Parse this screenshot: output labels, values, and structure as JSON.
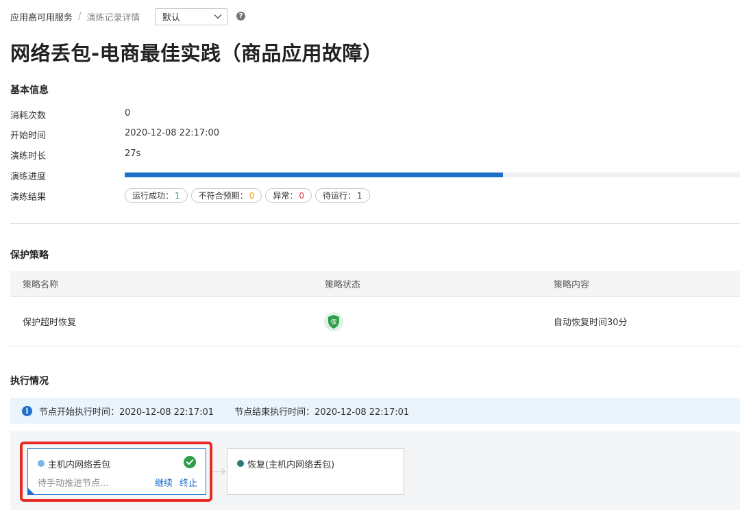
{
  "breadcrumb": {
    "root": "应用高可用服务",
    "separator": "/",
    "current": "演练记录详情"
  },
  "environment_select": {
    "value": "默认"
  },
  "page_title": "网络丢包-电商最佳实践（商品应用故障）",
  "basic_info": {
    "title": "基本信息",
    "fields": [
      {
        "label": "消耗次数",
        "value": "0"
      },
      {
        "label": "开始时间",
        "value": "2020-12-08 22:17:00"
      },
      {
        "label": "演练时长",
        "value": "27s"
      }
    ],
    "progress_label": "演练进度",
    "progress_fraction": 0.615,
    "results_label": "演练结果",
    "results": [
      {
        "label": "运行成功：",
        "count": "1",
        "color": "#2e9e4a"
      },
      {
        "label": "不符合预期：",
        "count": "0",
        "color": "#f39c12"
      },
      {
        "label": "异常：",
        "count": "0",
        "color": "#d9363e"
      },
      {
        "label": "待运行：",
        "count": "1",
        "color": "#333333"
      }
    ]
  },
  "protection": {
    "title": "保护策略",
    "columns": [
      "策略名称",
      "策略状态",
      "策略内容"
    ],
    "rows": [
      {
        "name": "保护超时恢复",
        "status_icon": "shield-icon",
        "status_glyph": "保",
        "content": "自动恢复时间30分"
      }
    ]
  },
  "execution": {
    "title": "执行情况",
    "alert": {
      "start": "节点开始执行时间：2020-12-08 22:17:01",
      "end": "节点结束执行时间：2020-12-08 22:17:01"
    },
    "nodes": [
      {
        "title": "主机内网络丢包",
        "dot_color": "#7fb4ea",
        "status": "待手动推进节点...",
        "continue_label": "继续",
        "stop_label": "终止",
        "done": true
      },
      {
        "title": "恢复(主机内网络丢包)",
        "dot_color": "#2a7a78"
      }
    ]
  },
  "colors": {
    "accent": "#1d70c9",
    "success": "#2e9e4a",
    "highlight_border": "#e62b24"
  }
}
